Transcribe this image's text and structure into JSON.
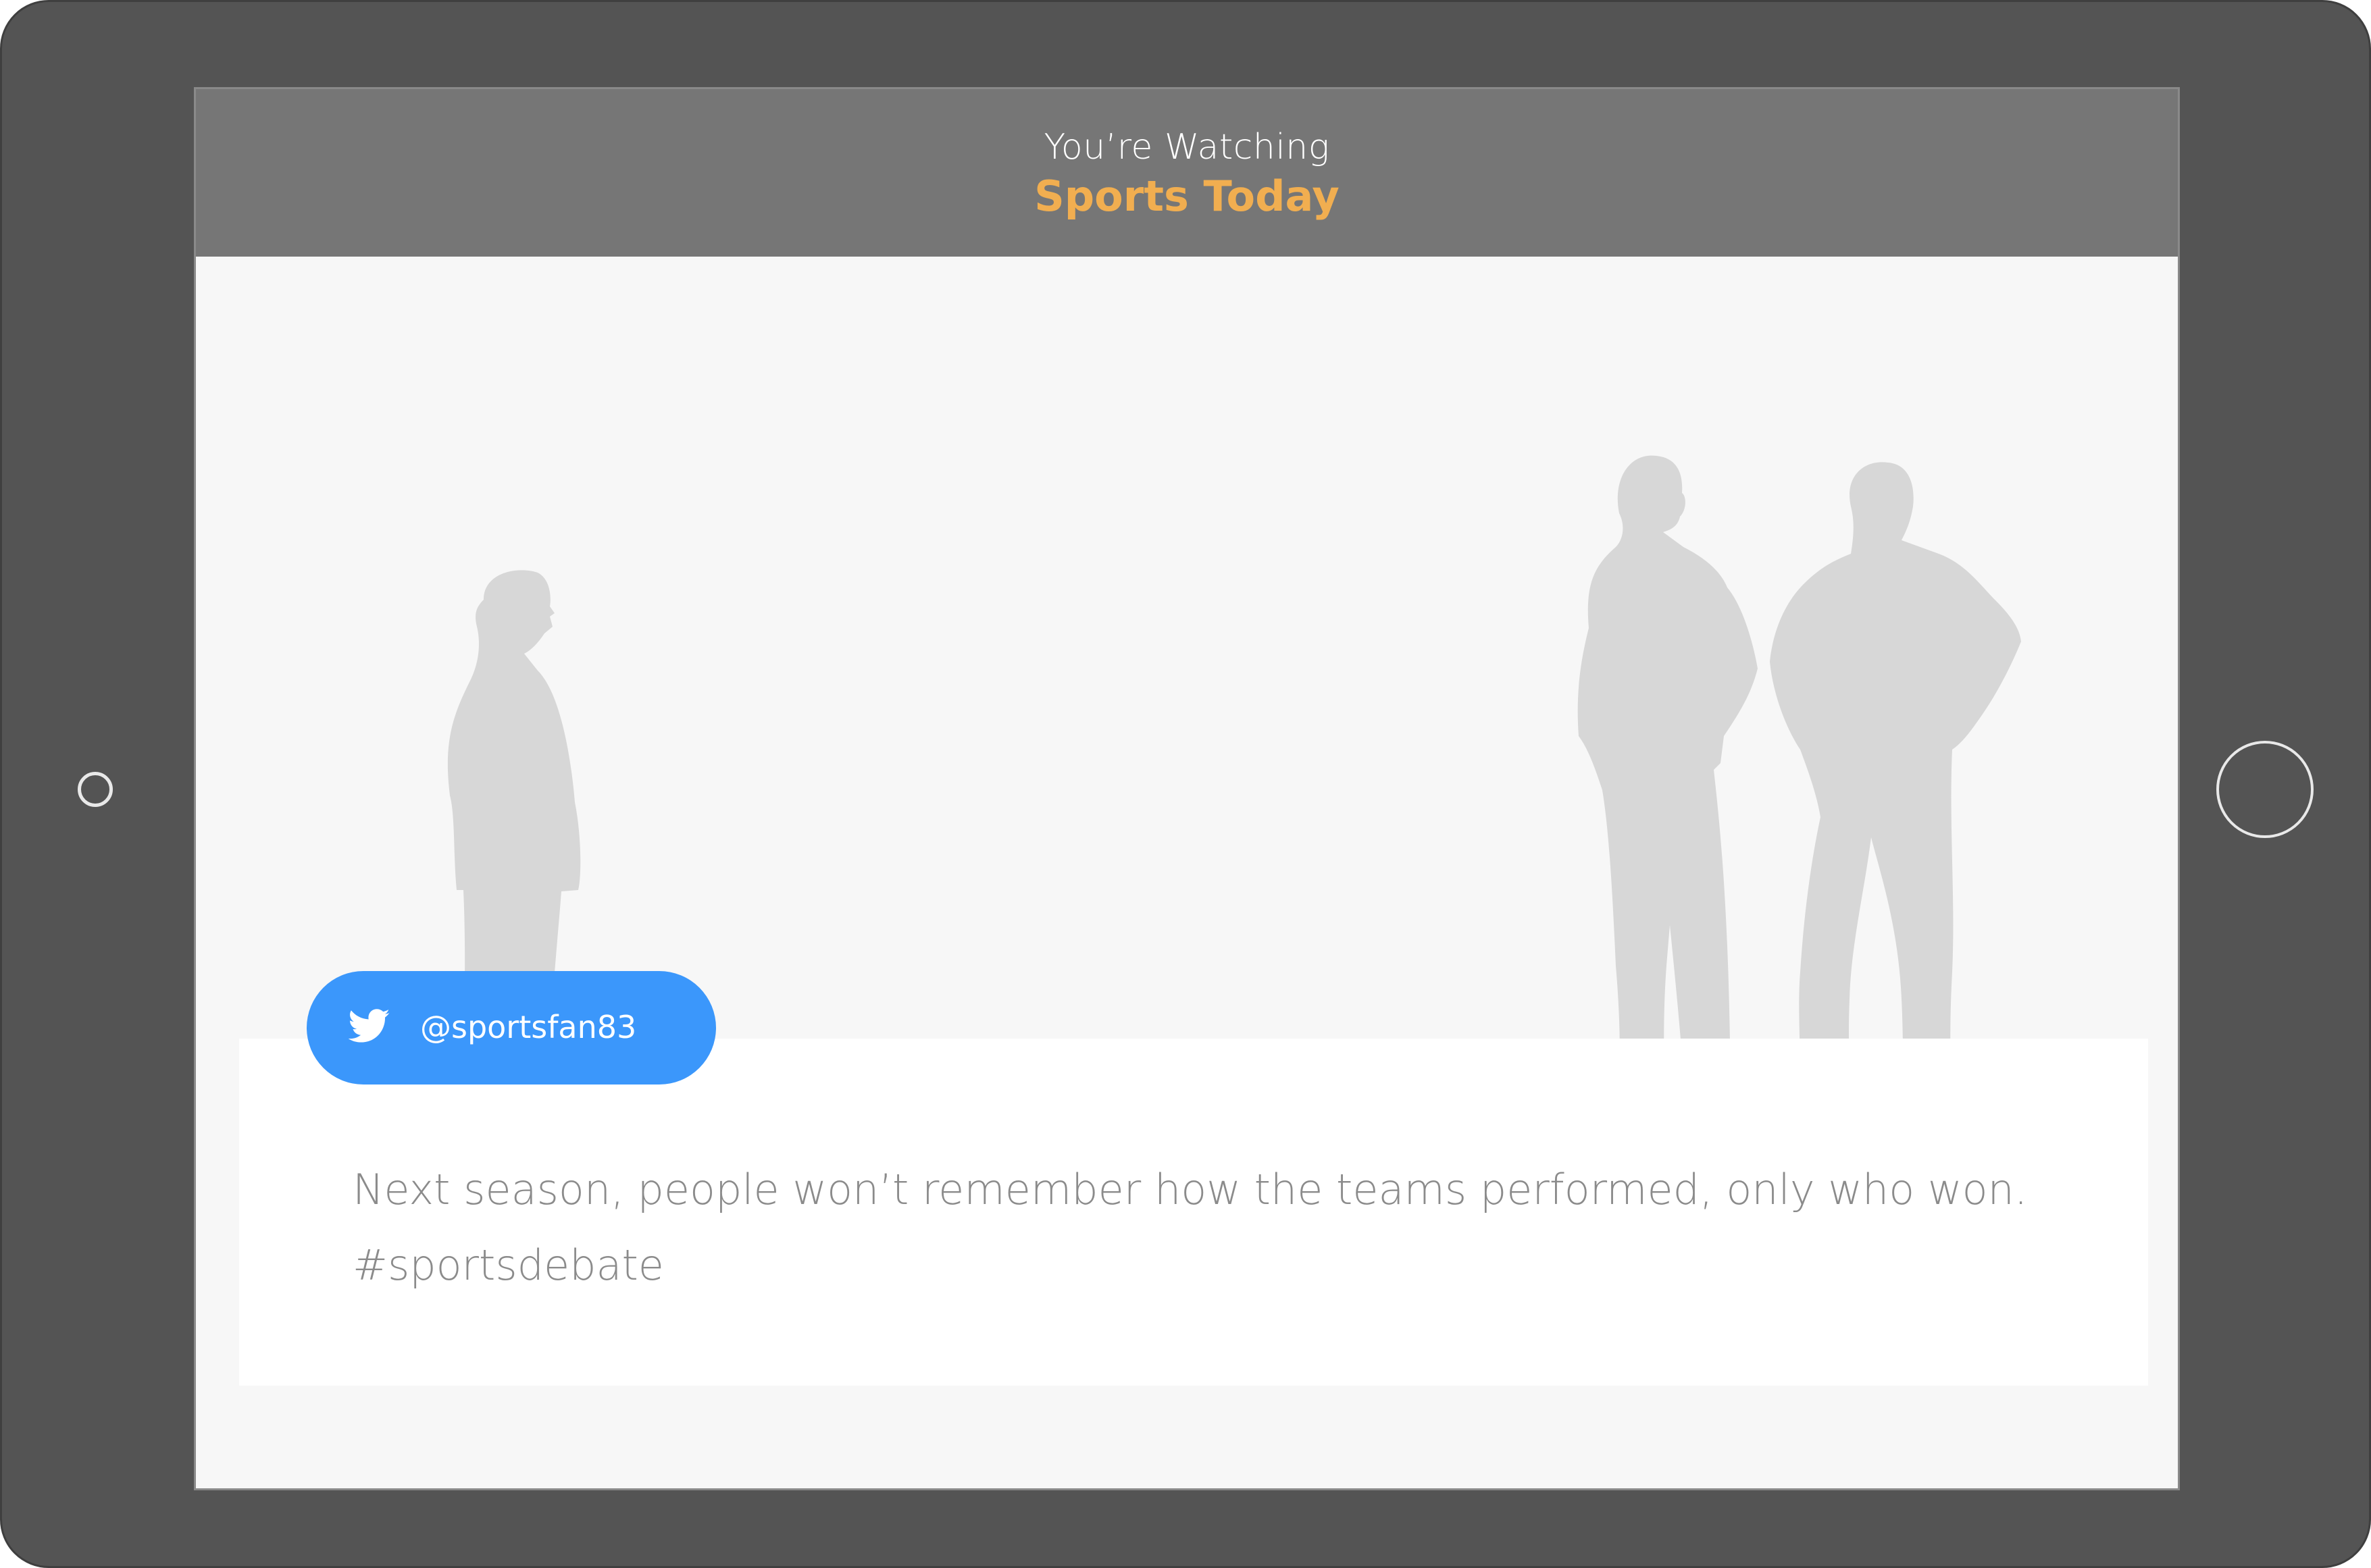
{
  "header": {
    "subtitle": "You’re Watching",
    "title": "Sports Today"
  },
  "tweet": {
    "handle": "@sportsfan83",
    "text": "Next season, people won’t remember how the teams performed, only who won. #sportsdebate",
    "icon": "twitter-bird-icon"
  },
  "colors": {
    "bezel": "#545454",
    "header_bg": "#767676",
    "accent": "#f1ae50",
    "twitter_blue": "#3b97fb",
    "silhouette": "#d7d7d7",
    "tweet_text": "#8b8b8b"
  }
}
